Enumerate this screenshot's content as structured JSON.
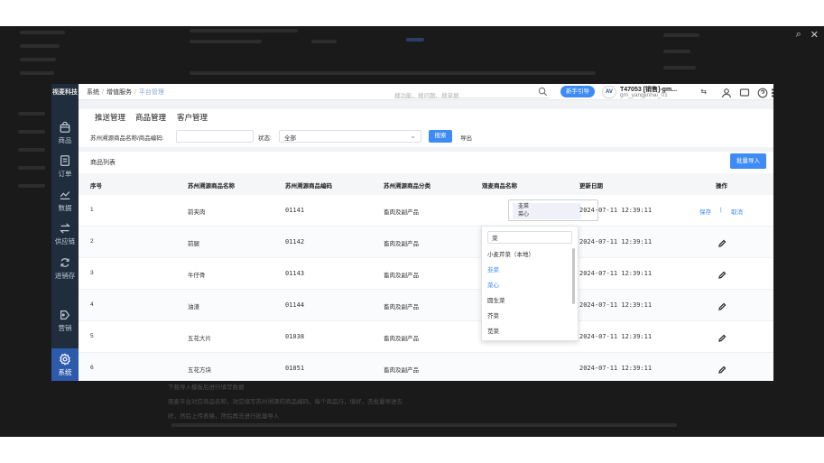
{
  "viewer": {
    "search_glyph": "⌕",
    "close_glyph": "✕"
  },
  "sidebar": {
    "logo": "视麦科技",
    "items": [
      {
        "label": "商品",
        "icon": "bag-icon",
        "active": false
      },
      {
        "label": "订单",
        "icon": "document-icon",
        "active": false
      },
      {
        "label": "数据",
        "icon": "line-chart-icon",
        "active": false
      },
      {
        "label": "供应链",
        "icon": "exchange-icon",
        "active": false
      },
      {
        "label": "进销存",
        "icon": "cycle-icon",
        "active": false
      },
      {
        "label": "营销",
        "icon": "tag-icon",
        "active": false
      },
      {
        "label": "系统",
        "icon": "gear-icon",
        "active": true
      }
    ]
  },
  "topbar": {
    "breadcrumb": [
      "系统",
      "增值服务",
      "平台管理"
    ],
    "breadcrumb_sep": "/",
    "search_placeholder": "搜功能、搜问题、搜单据",
    "guide_button": "新手引导",
    "user_avatar": "AV",
    "user_line1": "T47053 [销售]-gm...",
    "user_line2": "gm_yangjinhai_01",
    "switch_glyph": "⇆"
  },
  "subtabs": [
    "推送管理",
    "商品管理",
    "客户管理"
  ],
  "filters": {
    "name_label": "苏州溯源商品名称/商品编码:",
    "name_value": "",
    "status_label": "状态:",
    "status_value": "全部",
    "chevron": "⌄",
    "search_button": "搜索",
    "export_button": "导出"
  },
  "list": {
    "title": "商品列表",
    "batch_import": "批量导入",
    "columns": [
      "序号",
      "苏州溯源商品名称",
      "苏州溯源商品编码",
      "苏州溯源商品分类",
      "观麦商品名称",
      "更新日期",
      "操作"
    ],
    "rows": [
      {
        "no": "1",
        "name": "前夹肉",
        "code": "01141",
        "category": "畜肉及副产品",
        "gm_name": "",
        "date": "2024-07-11 12:39:11",
        "editing": true
      },
      {
        "no": "2",
        "name": "前腿",
        "code": "01142",
        "category": "畜肉及副产品",
        "gm_name": "",
        "date": "2024-07-11 12:39:11",
        "editing": false
      },
      {
        "no": "3",
        "name": "牛仔骨",
        "code": "01143",
        "category": "畜肉及副产品",
        "gm_name": "",
        "date": "2024-07-11 12:39:11",
        "editing": false
      },
      {
        "no": "4",
        "name": "油渣",
        "code": "01144",
        "category": "畜肉及副产品",
        "gm_name": "",
        "date": "2024-07-11 12:39:11",
        "editing": false
      },
      {
        "no": "5",
        "name": "五花大片",
        "code": "01038",
        "category": "畜肉及副产品",
        "gm_name": "",
        "date": "2024-07-11 12:39:11",
        "editing": false
      },
      {
        "no": "6",
        "name": "五花方块",
        "code": "01051",
        "category": "畜肉及副产品",
        "gm_name": "",
        "date": "2024-07-11 12:39:11",
        "editing": false
      }
    ],
    "selected_tags": [
      "韭菜",
      "菜心"
    ],
    "save_label": "保存",
    "op_sep": "|",
    "cancel_label": "取消"
  },
  "dropdown": {
    "search_value": "菜",
    "options": [
      {
        "label": "小麦芹菜（本地）",
        "selected": false
      },
      {
        "label": "韭菜",
        "selected": true
      },
      {
        "label": "菜心",
        "selected": true
      },
      {
        "label": "圆生菜",
        "selected": false
      },
      {
        "label": "芥菜",
        "selected": false
      },
      {
        "label": "苋菜",
        "selected": false
      }
    ]
  },
  "below_text": {
    "line1": "下载导入模板后进行填写数据",
    "line2": "观麦平台对应商品名称，对应填写苏州溯源的商品编码，每个商品行，填好，去批量导进去",
    "line3": "好，然后上传表格，然后再去进行批量导入"
  }
}
